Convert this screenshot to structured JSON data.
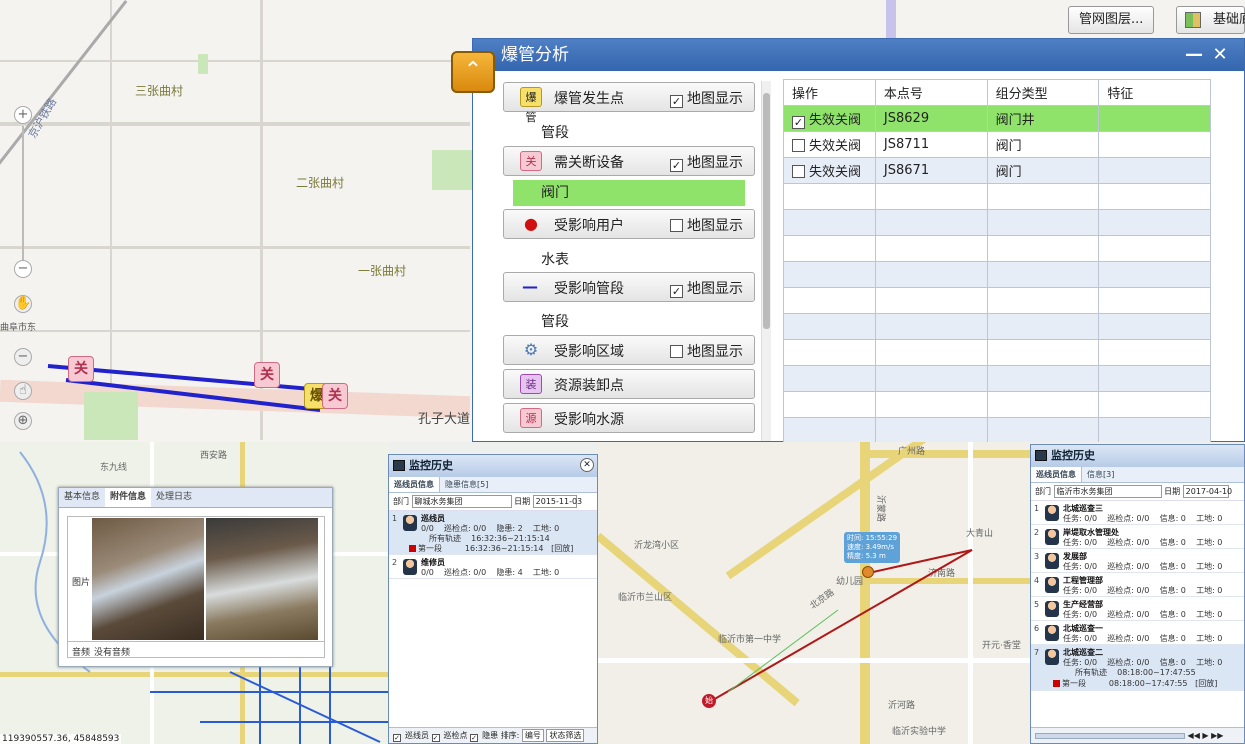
{
  "top_map": {
    "labels": [
      "三张曲村",
      "二张曲村",
      "一张曲村",
      "孔子大道",
      "曲阜市东"
    ],
    "rail_label": "京沪铁路",
    "markers": {
      "close": "关",
      "burst": "爆"
    },
    "toolbar": {
      "network_layer": "管网图层...",
      "base_map": "基础底"
    }
  },
  "burst_dialog": {
    "title": "爆管分析",
    "minimize": "—",
    "close": "✕",
    "legend": [
      {
        "type": "button",
        "icon": "爆管",
        "label": "爆管发生点",
        "checkbox_label": "地图显示",
        "checked": true
      },
      {
        "type": "text",
        "label": "管段"
      },
      {
        "type": "button",
        "icon": "关",
        "label": "需关断设备",
        "checkbox_label": "地图显示",
        "checked": true
      },
      {
        "type": "highlight",
        "label": "阀门"
      },
      {
        "type": "button",
        "icon": "●",
        "label": "受影响用户",
        "checkbox_label": "地图显示",
        "checked": false
      },
      {
        "type": "text",
        "label": "水表"
      },
      {
        "type": "button",
        "icon": "—",
        "label": "受影响管段",
        "checkbox_label": "地图显示",
        "checked": true
      },
      {
        "type": "text",
        "label": "管段"
      },
      {
        "type": "button",
        "icon": "⚙",
        "label": "受影响区域",
        "checkbox_label": "地图显示",
        "checked": false
      },
      {
        "type": "button",
        "icon": "装",
        "label": "资源装卸点",
        "checkbox_label": "",
        "checked": false
      },
      {
        "type": "button",
        "icon": "源",
        "label": "受影响水源",
        "checkbox_label": "",
        "checked": false
      }
    ],
    "table": {
      "headers": [
        "操作",
        "本点号",
        "组分类型",
        "特征"
      ],
      "rows": [
        {
          "action": "失效关阀",
          "point": "JS8629",
          "type": "阀门井",
          "feature": "",
          "checked": true
        },
        {
          "action": "失效关阀",
          "point": "JS8711",
          "type": "阀门",
          "feature": "",
          "checked": false
        },
        {
          "action": "失效关阀",
          "point": "JS8671",
          "type": "阀门",
          "feature": "",
          "checked": false
        }
      ]
    }
  },
  "photo_card": {
    "tabs": [
      "基本信息",
      "附件信息",
      "处理日志"
    ],
    "active_tab": 1,
    "image_label": "图片",
    "audio_label": "音频",
    "audio_value": "没有音频"
  },
  "monitor_left": {
    "title": "监控历史",
    "tabs": [
      "巡线员信息",
      "隐患信息[5]"
    ],
    "dept_label": "部门",
    "dept_value": "聊城水务集团",
    "date_label": "日期",
    "date_value": "2015-11-03",
    "rows": [
      {
        "idx": "1",
        "name": "巡线员",
        "stats": "0/0    巡检点: 0/0    隐患: 2    工地: 0",
        "track_label": "所有轨迹",
        "track_time": "16:32:36~21:15:14",
        "seg_label": "第一段",
        "seg_time": "16:32:36~21:15:14",
        "replay": "[回放]"
      },
      {
        "idx": "2",
        "name": "维修员",
        "stats": "0/0    巡检点: 0/0    隐患: 4    工地: 0"
      }
    ],
    "footer": [
      "巡线员",
      "巡检点",
      "隐患",
      "排序:",
      "编号",
      "状态筛选"
    ]
  },
  "monitor_right": {
    "title": "监控历史",
    "tabs": [
      "巡线员信息",
      "信息[3]"
    ],
    "dept_label": "部门",
    "dept_value": "临沂市水务集团",
    "date_label": "日期",
    "date_value": "2017-04-10",
    "rows": [
      {
        "idx": "1",
        "name": "北城巡查三",
        "stats": "任务: 0/0    巡检点: 0/0    信息: 0    工地: 0"
      },
      {
        "idx": "2",
        "name": "岸堤取水管理处",
        "stats": "任务: 0/0    巡检点: 0/0    信息: 0    工地: 0"
      },
      {
        "idx": "3",
        "name": "发展部",
        "stats": "任务: 0/0    巡检点: 0/0    信息: 0    工地: 0"
      },
      {
        "idx": "4",
        "name": "工程管理部",
        "stats": "任务: 0/0    巡检点: 0/0    信息: 0    工地: 0"
      },
      {
        "idx": "5",
        "name": "生产经营部",
        "stats": "任务: 0/0    巡检点: 0/0    信息: 0    工地: 0"
      },
      {
        "idx": "6",
        "name": "北城巡查一",
        "stats": "任务: 0/0    巡检点: 0/0    信息: 0    工地: 0"
      },
      {
        "idx": "7",
        "name": "北城巡查二",
        "stats": "任务: 0/0    巡检点: 0/0    信息: 0    工地: 0",
        "track_label": "所有轨迹",
        "track_time": "08:18:00~17:47:55",
        "seg_label": "第一段",
        "seg_time": "08:18:00~17:47:55",
        "replay": "[回放]"
      }
    ]
  },
  "bottom_map": {
    "coords": "119390557.36, 45848593",
    "labels": [
      "西安路",
      "东九线",
      "广州路",
      "临沂市兰山区",
      "沂龙湾小区",
      "北京路",
      "沂蒙路",
      "济南路",
      "临沂市第一中学",
      "开元·香堂",
      "大青山",
      "沂河路",
      "临沂实验中学",
      "幼儿园"
    ],
    "bubble": "时间: 15:55:29\n速度: 3.49m/s\n精度: 5.3 m"
  }
}
